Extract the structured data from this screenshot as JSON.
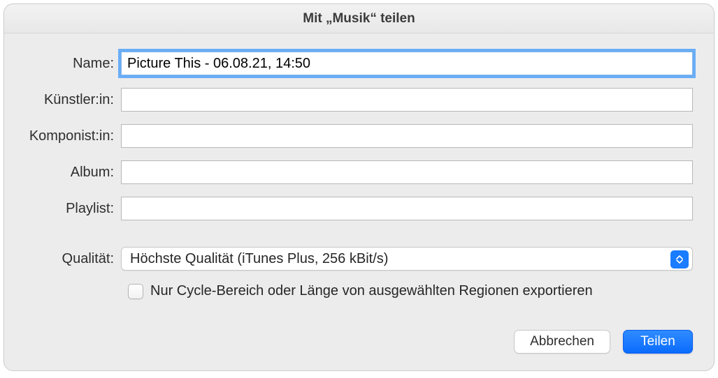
{
  "title": "Mit „Musik“ teilen",
  "labels": {
    "name": "Name:",
    "artist": "Künstler:in:",
    "composer": "Komponist:in:",
    "album": "Album:",
    "playlist": "Playlist:",
    "quality": "Qualität:"
  },
  "values": {
    "name": "Picture This - 06.08.21, 14:50",
    "artist": "",
    "composer": "",
    "album": "",
    "playlist": ""
  },
  "quality": {
    "selected": "Höchste Qualität (iTunes Plus, 256 kBit/s)"
  },
  "checkbox": {
    "label": "Nur Cycle-Bereich oder Länge von ausgewählten Regionen exportieren",
    "checked": false
  },
  "buttons": {
    "cancel": "Abbrechen",
    "share": "Teilen"
  }
}
